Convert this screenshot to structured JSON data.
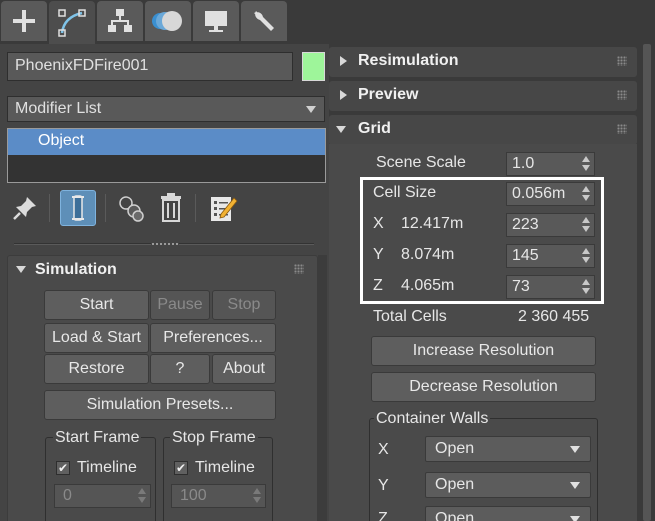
{
  "tabs": [
    {
      "name": "create-tab",
      "icon": "plus-icon",
      "active": false
    },
    {
      "name": "modify-tab",
      "icon": "modify-icon",
      "active": true
    },
    {
      "name": "hierarchy-tab",
      "icon": "hierarchy-icon",
      "active": false
    },
    {
      "name": "motion-tab",
      "icon": "motion-icon",
      "active": false
    },
    {
      "name": "display-tab",
      "icon": "display-icon",
      "active": false
    },
    {
      "name": "utilities-tab",
      "icon": "wrench-icon",
      "active": false
    }
  ],
  "object": {
    "name": "PhoenixFDFire001",
    "color": "#9ef59a"
  },
  "modifier_list": {
    "label": "Modifier List",
    "stack_items": [
      "Object"
    ]
  },
  "stack_tools": [
    "pin-icon",
    "show-end-result-icon",
    "make-unique-icon",
    "remove-modifier-icon",
    "configure-sets-icon"
  ],
  "simulation": {
    "title": "Simulation",
    "start": "Start",
    "pause": "Pause",
    "stop": "Stop",
    "load_start": "Load & Start",
    "preferences": "Preferences...",
    "restore": "Restore",
    "help": "?",
    "about": "About",
    "presets": "Simulation Presets...",
    "start_frame": {
      "label": "Start Frame",
      "timeline_label": "Timeline",
      "timeline_checked": true,
      "value": "0"
    },
    "stop_frame": {
      "label": "Stop Frame",
      "timeline_label": "Timeline",
      "timeline_checked": true,
      "value": "100"
    }
  },
  "right_rollouts": {
    "resimulation": "Resimulation",
    "preview": "Preview",
    "grid": "Grid"
  },
  "grid": {
    "scene_scale_label": "Scene Scale",
    "scene_scale_value": "1.0",
    "cell_size_label": "Cell Size",
    "cell_size_value": "0.056m",
    "x_label": "X",
    "x_size": "12.417m",
    "x_cells": "223",
    "y_label": "Y",
    "y_size": "8.074m",
    "y_cells": "145",
    "z_label": "Z",
    "z_size": "4.065m",
    "z_cells": "73",
    "total_cells_label": "Total Cells",
    "total_cells_value": "2 360 455",
    "increase": "Increase Resolution",
    "decrease": "Decrease Resolution",
    "container_walls": {
      "label": "Container Walls",
      "x_label": "X",
      "x_value": "Open",
      "y_label": "Y",
      "y_value": "Open",
      "z_label": "Z",
      "z_value": "Open"
    }
  },
  "colors": {
    "selection": "#5b8cc7",
    "active_tool": "#5e8fb8",
    "highlight_box": "#ffffff"
  }
}
